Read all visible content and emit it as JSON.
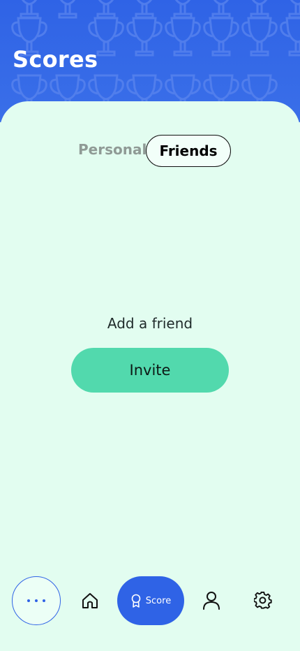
{
  "header": {
    "title": "Scores"
  },
  "tabs": [
    {
      "label": "Personal",
      "active": false
    },
    {
      "label": "Friends",
      "active": true
    }
  ],
  "empty_state": {
    "message": "Add a friend",
    "invite_label": "Invite"
  },
  "bottom_nav": {
    "items": [
      {
        "icon": "more-dots-icon",
        "active": false
      },
      {
        "icon": "home-icon",
        "active": false
      },
      {
        "icon": "award-icon",
        "label": "Score",
        "active": true
      },
      {
        "icon": "user-icon",
        "active": false
      },
      {
        "icon": "gear-icon",
        "active": false
      }
    ]
  },
  "colors": {
    "header_blue": "#2f63e6",
    "background_mint": "#e2fdf0",
    "invite_green": "#52d9ad"
  }
}
